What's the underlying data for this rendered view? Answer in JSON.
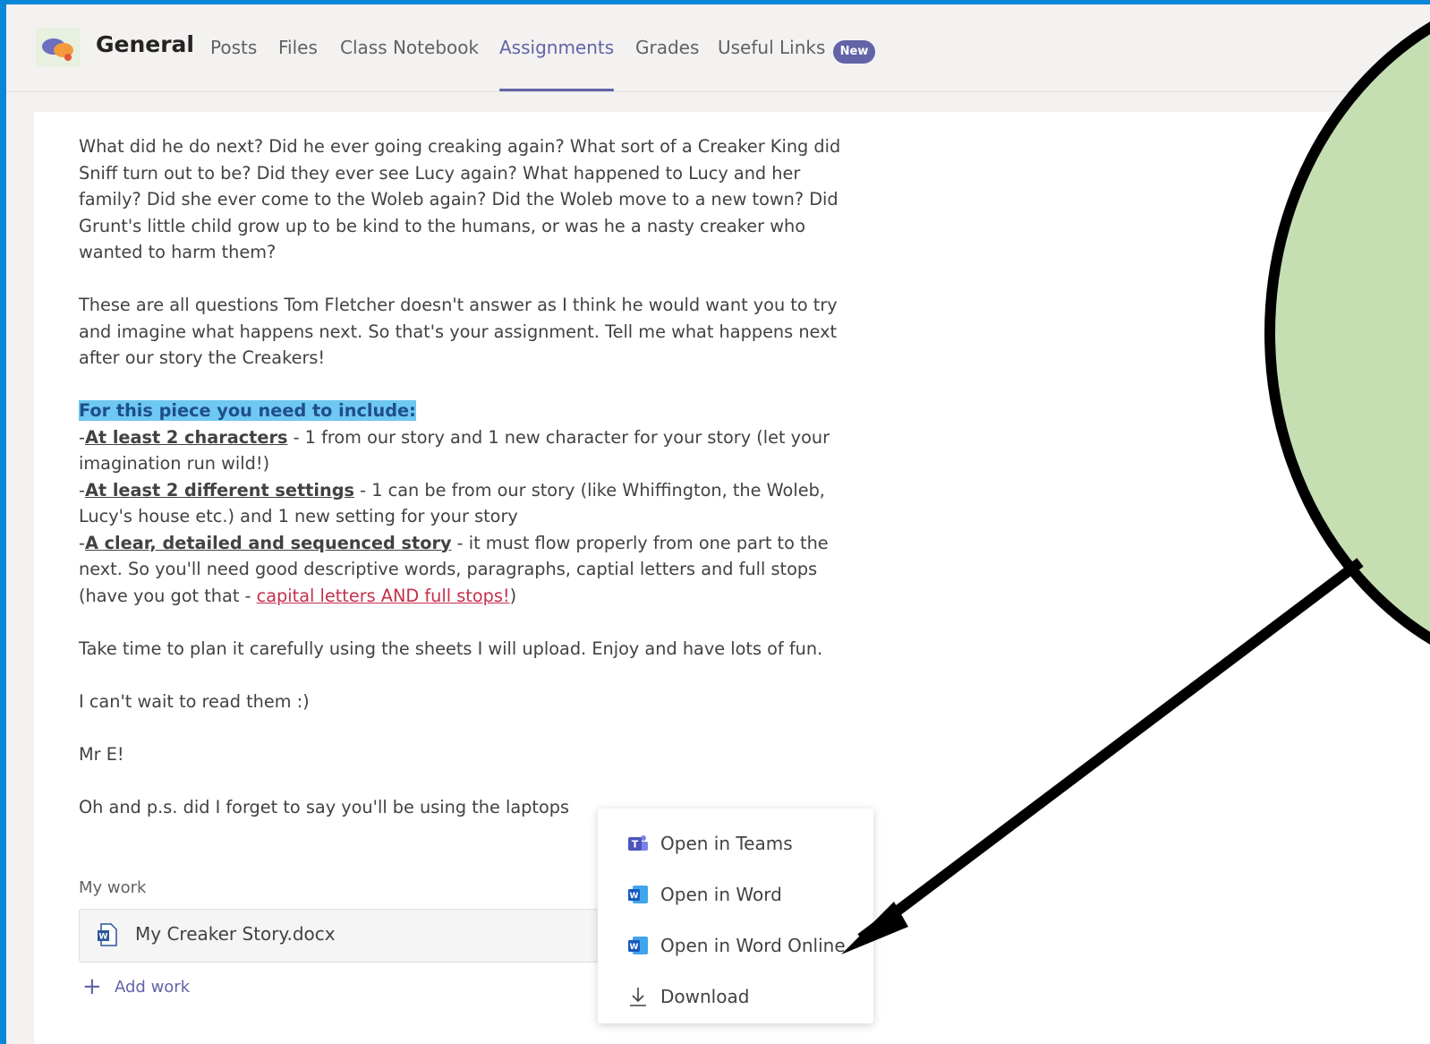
{
  "header": {
    "channel_name": "General",
    "tabs": [
      {
        "label": "Posts"
      },
      {
        "label": "Files"
      },
      {
        "label": "Class Notebook"
      },
      {
        "label": "Assignments"
      },
      {
        "label": "Grades"
      },
      {
        "label": "Useful Links"
      }
    ],
    "active_tab": "Assignments",
    "new_badge": "New"
  },
  "assignment": {
    "para1": "What did he do next?  Did he ever going creaking again?  What sort of a Creaker King did Sniff turn out to be?  Did they ever see Lucy again?  What happened to Lucy and her family?  Did she ever come to the Woleb again?  Did the Woleb move to a new town?  Did Grunt's little child grow up to be kind to the humans, or was he a nasty creaker who wanted to harm them?",
    "para2": "These are all questions Tom Fletcher doesn't answer as I think he would want you to try and imagine what happens next.  So that's your assignment.  Tell me what happens next after our story the Creakers!",
    "include_heading": "For this piece you need to include:",
    "req1_title": "At least 2 characters",
    "req1_text": " - 1 from our story and 1 new character for your story (let your imagination run wild!)",
    "req2_title": "At least 2 different settings",
    "req2_text": " - 1 can be from our story (like Whiffington, the Woleb, Lucy's house etc.) and 1 new setting for your story",
    "req3_title": "A clear, detailed and sequenced story",
    "req3_text": " - it must flow properly from one part to the next.  So you'll need good descriptive words, paragraphs, captial letters and full stops (have you got that - ",
    "req3_red": "capital letters AND full stops!",
    "req3_close": ")",
    "para3": "Take time to plan it carefully using the sheets I will upload.  Enjoy and have lots of fun.",
    "para4": "I can't wait to read them :)",
    "signature": "Mr E!",
    "para5": "Oh and p.s. did I forget to say you'll be using the laptops"
  },
  "my_work": {
    "label": "My work",
    "file_name": "My Creaker Story.docx",
    "more_icon": "more-options-icon",
    "more_glyph": "•••",
    "add_work_label": "Add work"
  },
  "context_menu": {
    "items": [
      {
        "label": "Open in Teams",
        "icon": "teams-icon"
      },
      {
        "label": "Open in Word",
        "icon": "word-icon"
      },
      {
        "label": "Open in Word Online",
        "icon": "word-icon"
      },
      {
        "label": "Download",
        "icon": "download-icon"
      }
    ]
  },
  "colors": {
    "accent": "#6264a7",
    "frame_border": "#0a86d8",
    "highlight": "#6ec8f2",
    "callout_fill": "#c5dfb3",
    "link_red": "#c4314b"
  }
}
